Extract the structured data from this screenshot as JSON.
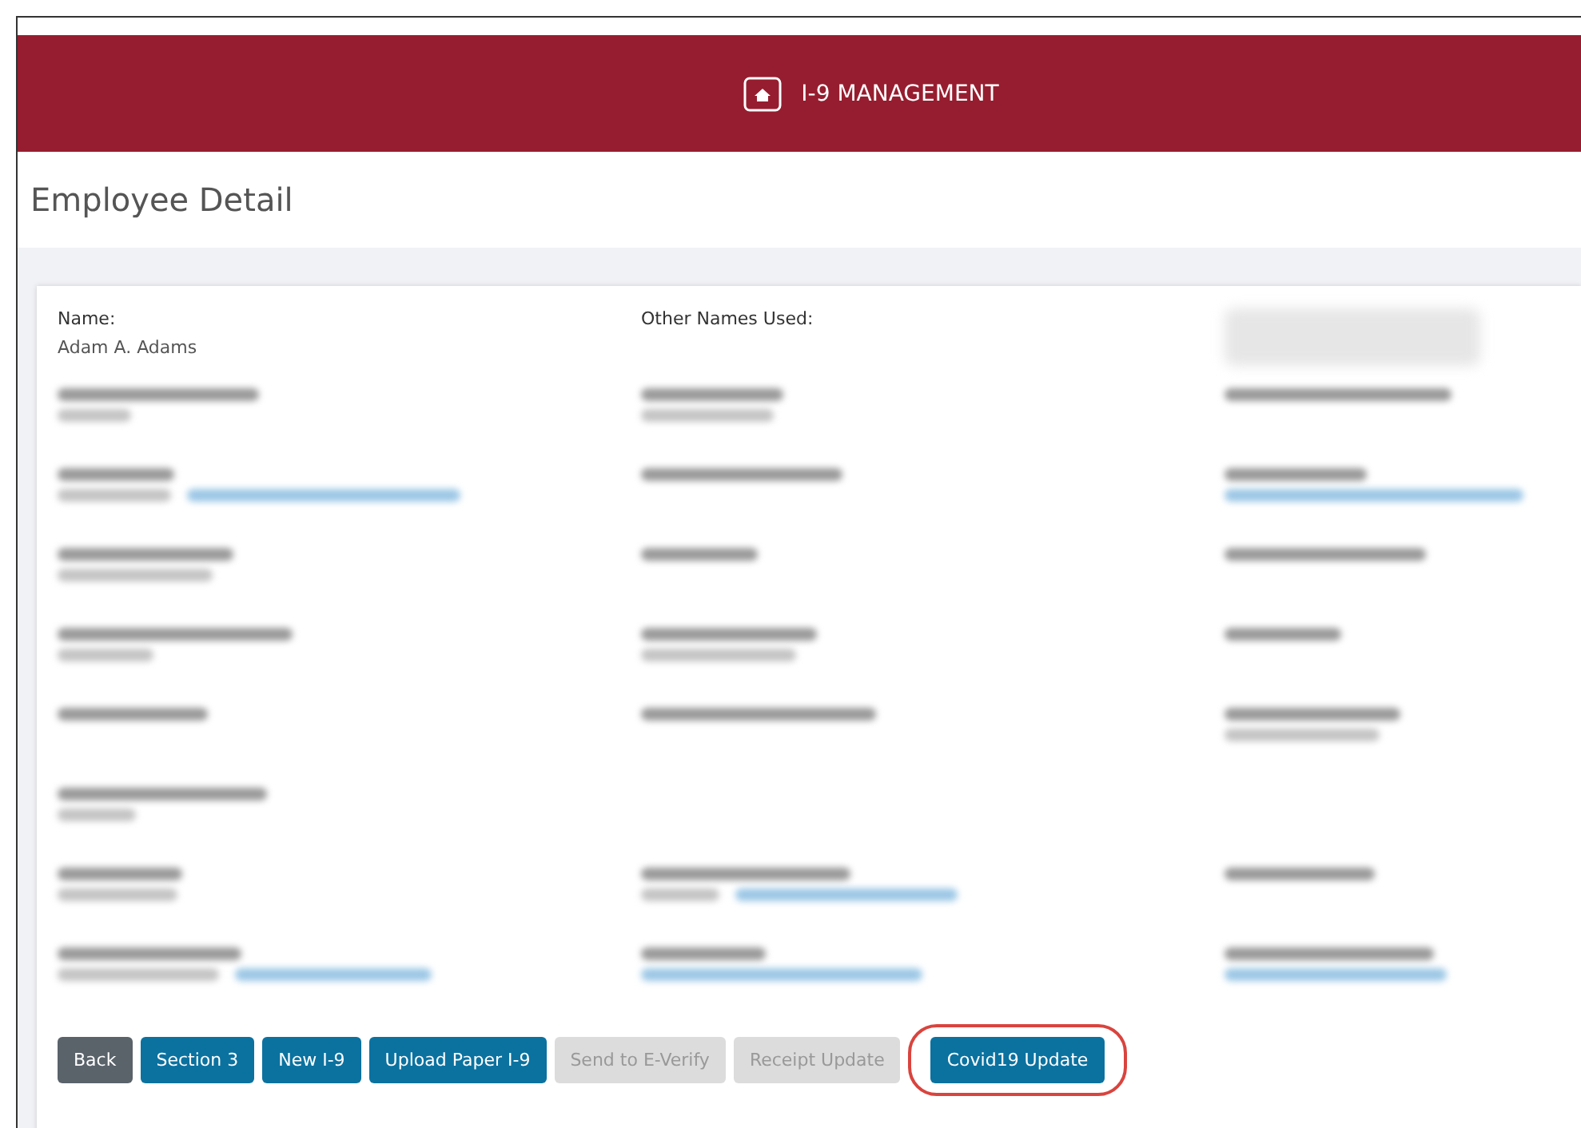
{
  "header": {
    "title": "I-9 MANAGEMENT"
  },
  "page_title": "Employee Detail",
  "rows": [
    [
      {
        "kind": "text",
        "label": "Name:",
        "value": "Adam A. Adams"
      },
      {
        "kind": "text",
        "label": "Other Names Used:"
      },
      {
        "kind": "smudge"
      }
    ],
    [
      {
        "kind": "pair"
      },
      {
        "kind": "pair"
      },
      {
        "kind": "label"
      }
    ],
    [
      {
        "kind": "pair_link"
      },
      {
        "kind": "label"
      },
      {
        "kind": "label_link"
      }
    ],
    [
      {
        "kind": "pair"
      },
      {
        "kind": "label"
      },
      {
        "kind": "label"
      }
    ],
    [
      {
        "kind": "pair"
      },
      {
        "kind": "pair"
      },
      {
        "kind": "label"
      }
    ],
    [
      {
        "kind": "label"
      },
      {
        "kind": "label"
      },
      {
        "kind": "pair"
      }
    ],
    [
      {
        "kind": "pair"
      },
      {
        "kind": "empty"
      },
      {
        "kind": "empty"
      }
    ],
    [
      {
        "kind": "pair"
      },
      {
        "kind": "pair_link"
      },
      {
        "kind": "label"
      }
    ],
    [
      {
        "kind": "pair_link"
      },
      {
        "kind": "label_link"
      },
      {
        "kind": "label_link"
      }
    ]
  ],
  "buttons": [
    {
      "label": "Back",
      "kind": "secondary",
      "highlighted": false
    },
    {
      "label": "Section 3",
      "kind": "primary",
      "highlighted": false
    },
    {
      "label": "New I-9",
      "kind": "primary",
      "highlighted": false
    },
    {
      "label": "Upload Paper I-9",
      "kind": "primary",
      "highlighted": false
    },
    {
      "label": "Send to E-Verify",
      "kind": "disabled",
      "highlighted": false
    },
    {
      "label": "Receipt Update",
      "kind": "disabled",
      "highlighted": false
    },
    {
      "label": "Covid19 Update",
      "kind": "primary",
      "highlighted": true
    }
  ]
}
